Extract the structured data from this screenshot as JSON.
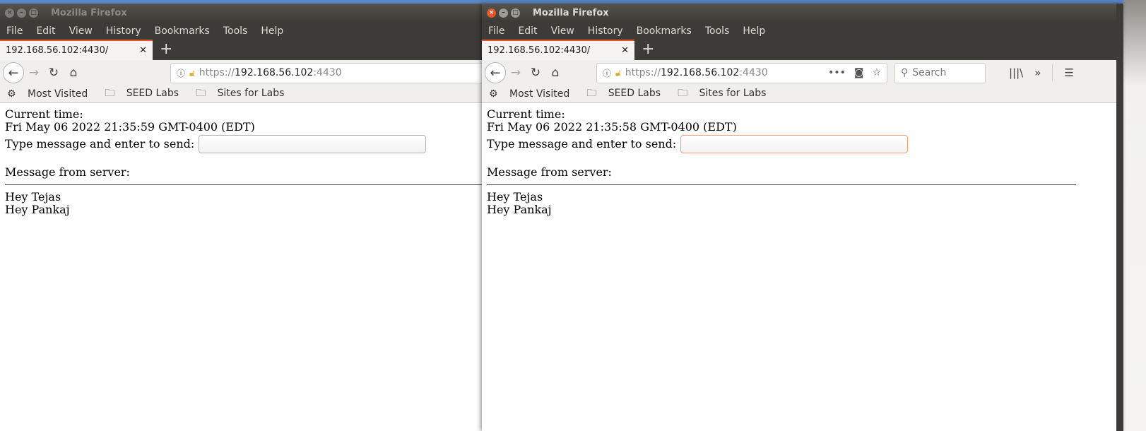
{
  "app_title": "Mozilla Firefox",
  "menu": [
    "File",
    "Edit",
    "View",
    "History",
    "Bookmarks",
    "Tools",
    "Help"
  ],
  "tab_title": "192.168.56.102:4430/",
  "url": {
    "scheme": "https://",
    "host": "192.168.56.102",
    "port": ":4430"
  },
  "search_placeholder": "Search",
  "bookmarks": [
    "Most Visited",
    "SEED Labs",
    "Sites for Labs"
  ],
  "page": {
    "current_time_label": "Current time:",
    "prompt": "Type message and enter to send:",
    "server_label": "Message from server:",
    "messages": [
      "Hey Tejas",
      "Hey Pankaj"
    ]
  },
  "left_window": {
    "time": "Fri May 06 2022 21:35:59 GMT-0400 (EDT)",
    "input_value": ""
  },
  "right_window": {
    "time": "Fri May 06 2022 21:35:58 GMT-0400 (EDT)",
    "input_value": "",
    "input_focused": true
  },
  "colors": {
    "accent": "#e9542b",
    "titlebar": "#3c3b37"
  }
}
